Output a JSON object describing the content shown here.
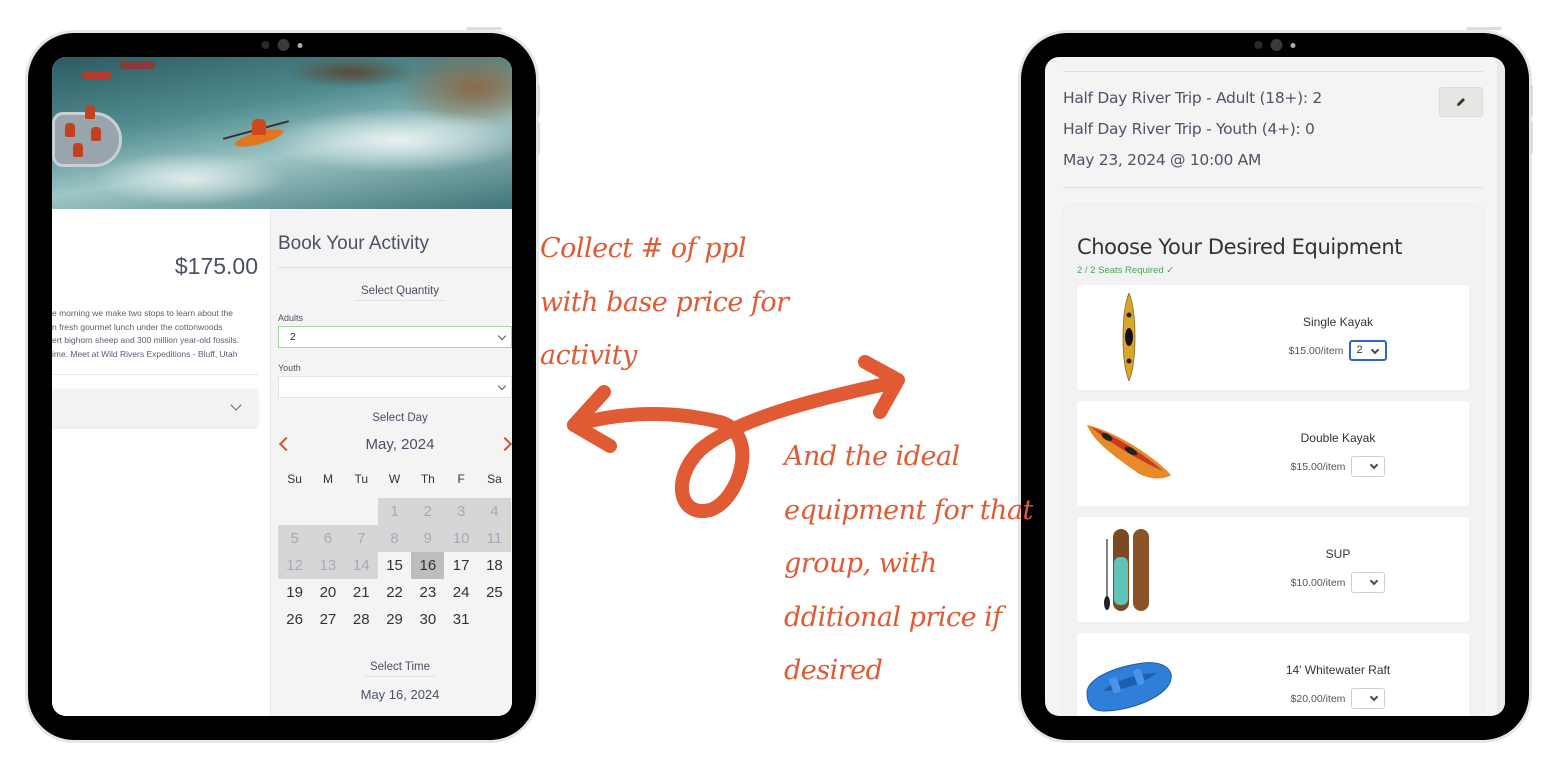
{
  "left_tablet": {
    "activity": {
      "price": "$175.00",
      "description_lines": [
        "e morning we make two stops to learn about the",
        "n fresh gourmet lunch under the cottonwoods",
        "ert bighorn sheep and 300 million year-old fossils.",
        "ime. Meet at Wild Rivers Expeditions - Bluff, Utah"
      ]
    },
    "booking": {
      "title": "Book Your Activity",
      "select_quantity_label": "Select Quantity",
      "adults_label": "Adults",
      "adults_value": "2",
      "youth_label": "Youth",
      "youth_value": "",
      "select_day_label": "Select Day",
      "calendar": {
        "month": "May, 2024",
        "weekdays": [
          "Su",
          "M",
          "Tu",
          "W",
          "Th",
          "F",
          "Sa"
        ],
        "first_weekday_index": 3,
        "days_in_month": 31,
        "disabled_through": 14,
        "selected_day": 16,
        "accent_color": "#d4542c"
      },
      "select_time_label": "Select Time",
      "selected_date": "May 16, 2024"
    }
  },
  "right_tablet": {
    "summary": {
      "lines": [
        "Half Day River Trip - Adult (18+): 2",
        "Half Day River Trip - Youth (4+): 0",
        "May 23, 2024 @ 10:00 AM"
      ]
    },
    "equipment": {
      "title": "Choose Your Desired Equipment",
      "seats_status": "2 / 2 Seats Required ✓",
      "seats_color": "#4ba35a",
      "items": [
        {
          "name": "Single Kayak",
          "price": "$15.00/item",
          "quantity": "2"
        },
        {
          "name": "Double Kayak",
          "price": "$15.00/item",
          "quantity": ""
        },
        {
          "name": "SUP",
          "price": "$10.00/item",
          "quantity": ""
        },
        {
          "name": "14' Whitewater Raft",
          "price": "$20.00/item",
          "quantity": ""
        }
      ]
    }
  },
  "annotations": {
    "color": "#e05a33",
    "left_note": [
      "Collect # of ppl",
      "with base price for",
      "activity"
    ],
    "right_note": [
      "And the ideal",
      "equipment for that",
      "group, with",
      "dditional price if",
      "desired"
    ]
  }
}
